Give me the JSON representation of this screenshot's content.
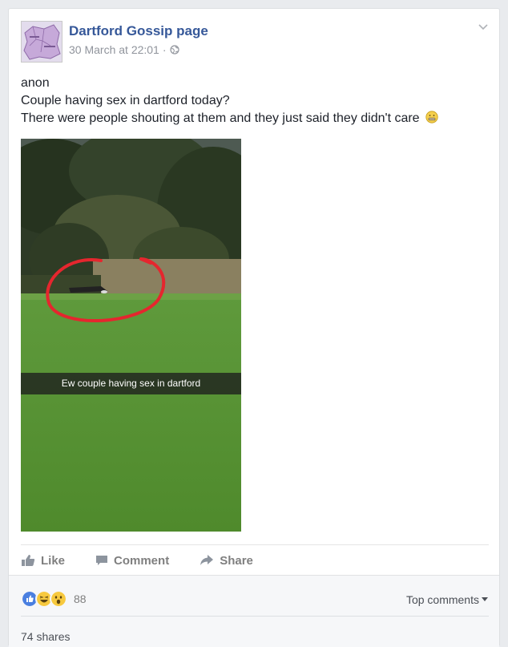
{
  "post": {
    "page_name": "Dartford Gossip page",
    "timestamp": "30 March at 22:01",
    "separator": "·",
    "privacy_icon": "globe-icon",
    "lines": [
      "anon",
      "Couple having sex in dartford today?",
      "There were people shouting at them and they just said they didn't care"
    ],
    "emoji": "grimacing-face-emoji",
    "photo_caption": "Ew couple having sex in dartford"
  },
  "actions": {
    "like": "Like",
    "comment": "Comment",
    "share": "Share"
  },
  "footer": {
    "reaction_icons": [
      "like-reaction-icon",
      "haha-reaction-icon",
      "wow-reaction-icon"
    ],
    "reaction_count": "88",
    "top_comments": "Top comments",
    "shares": "74 shares"
  },
  "colors": {
    "link_blue": "#365899",
    "text": "#1d2129",
    "meta_grey": "#90949c",
    "action_grey": "#7f7f7f",
    "page_bg": "#e9ebee"
  }
}
